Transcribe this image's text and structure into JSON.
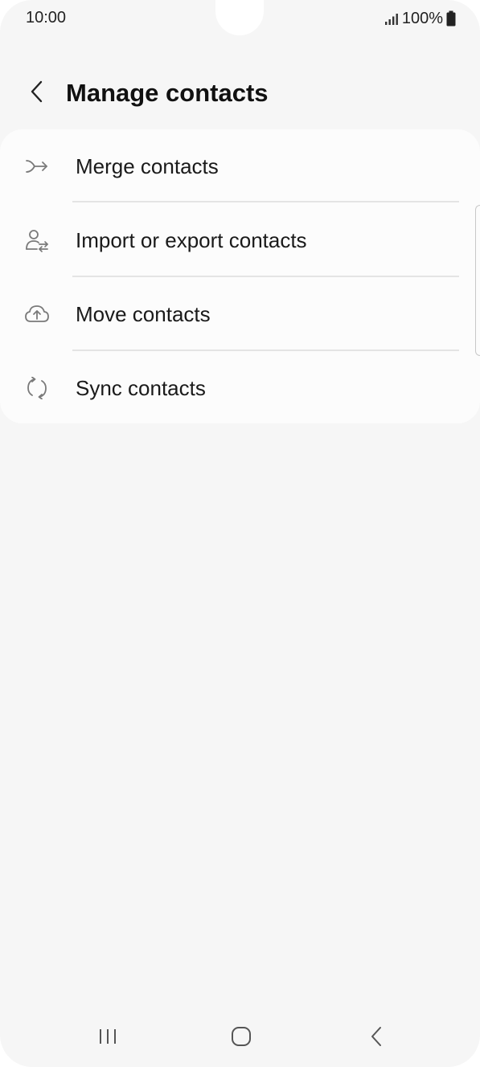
{
  "status_bar": {
    "time": "10:00",
    "battery": "100%",
    "icons": [
      "signal-icon",
      "battery-icon"
    ]
  },
  "header": {
    "title": "Manage contacts",
    "back_icon": "chevron-left-icon"
  },
  "menu": {
    "items": [
      {
        "label": "Merge contacts",
        "icon": "merge-arrow-icon"
      },
      {
        "label": "Import or export contacts",
        "icon": "person-transfer-icon"
      },
      {
        "label": "Move contacts",
        "icon": "cloud-upload-icon"
      },
      {
        "label": "Sync contacts",
        "icon": "sync-icon"
      }
    ]
  },
  "nav_bar": {
    "buttons": [
      "recent-apps-icon",
      "home-icon",
      "back-icon"
    ]
  },
  "colors": {
    "background": "#f6f6f6",
    "card": "#fcfcfc",
    "divider": "#e4e4e4",
    "icon": "#7a7a7a",
    "text": "#1a1a1a"
  }
}
